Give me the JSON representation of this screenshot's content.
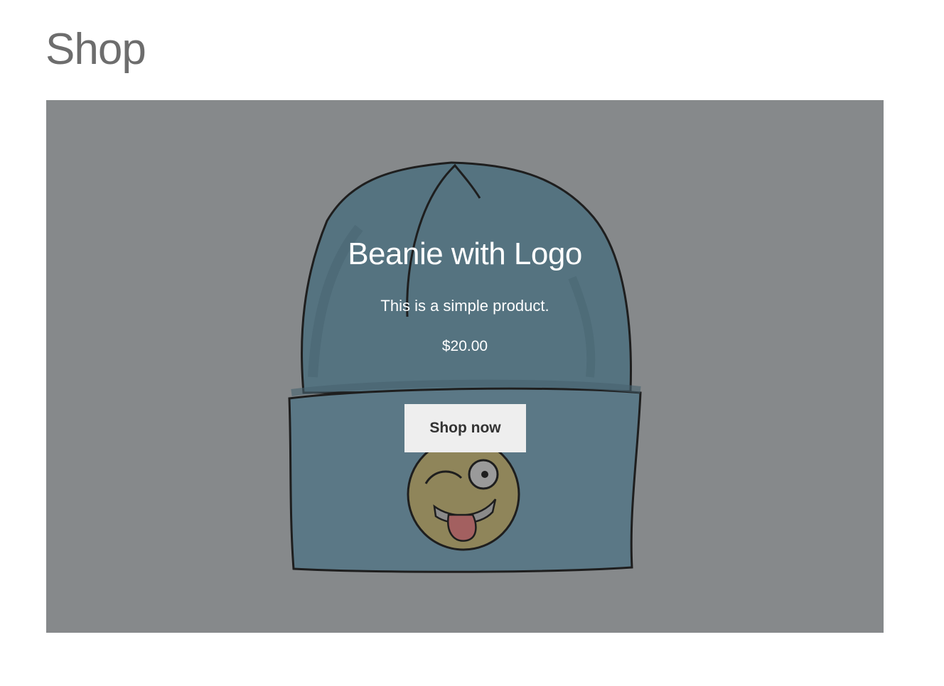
{
  "page": {
    "title": "Shop"
  },
  "hero": {
    "background_color": "#86898b",
    "image": "beanie-with-logo-illustration",
    "product": {
      "title": "Beanie with Logo",
      "description": "This is a simple product.",
      "price": "$20.00",
      "button_label": "Shop now"
    }
  },
  "colors": {
    "title": "#6d6d6d",
    "beanie": "#557380",
    "button_bg": "#eeeeee",
    "button_text": "#333333"
  }
}
